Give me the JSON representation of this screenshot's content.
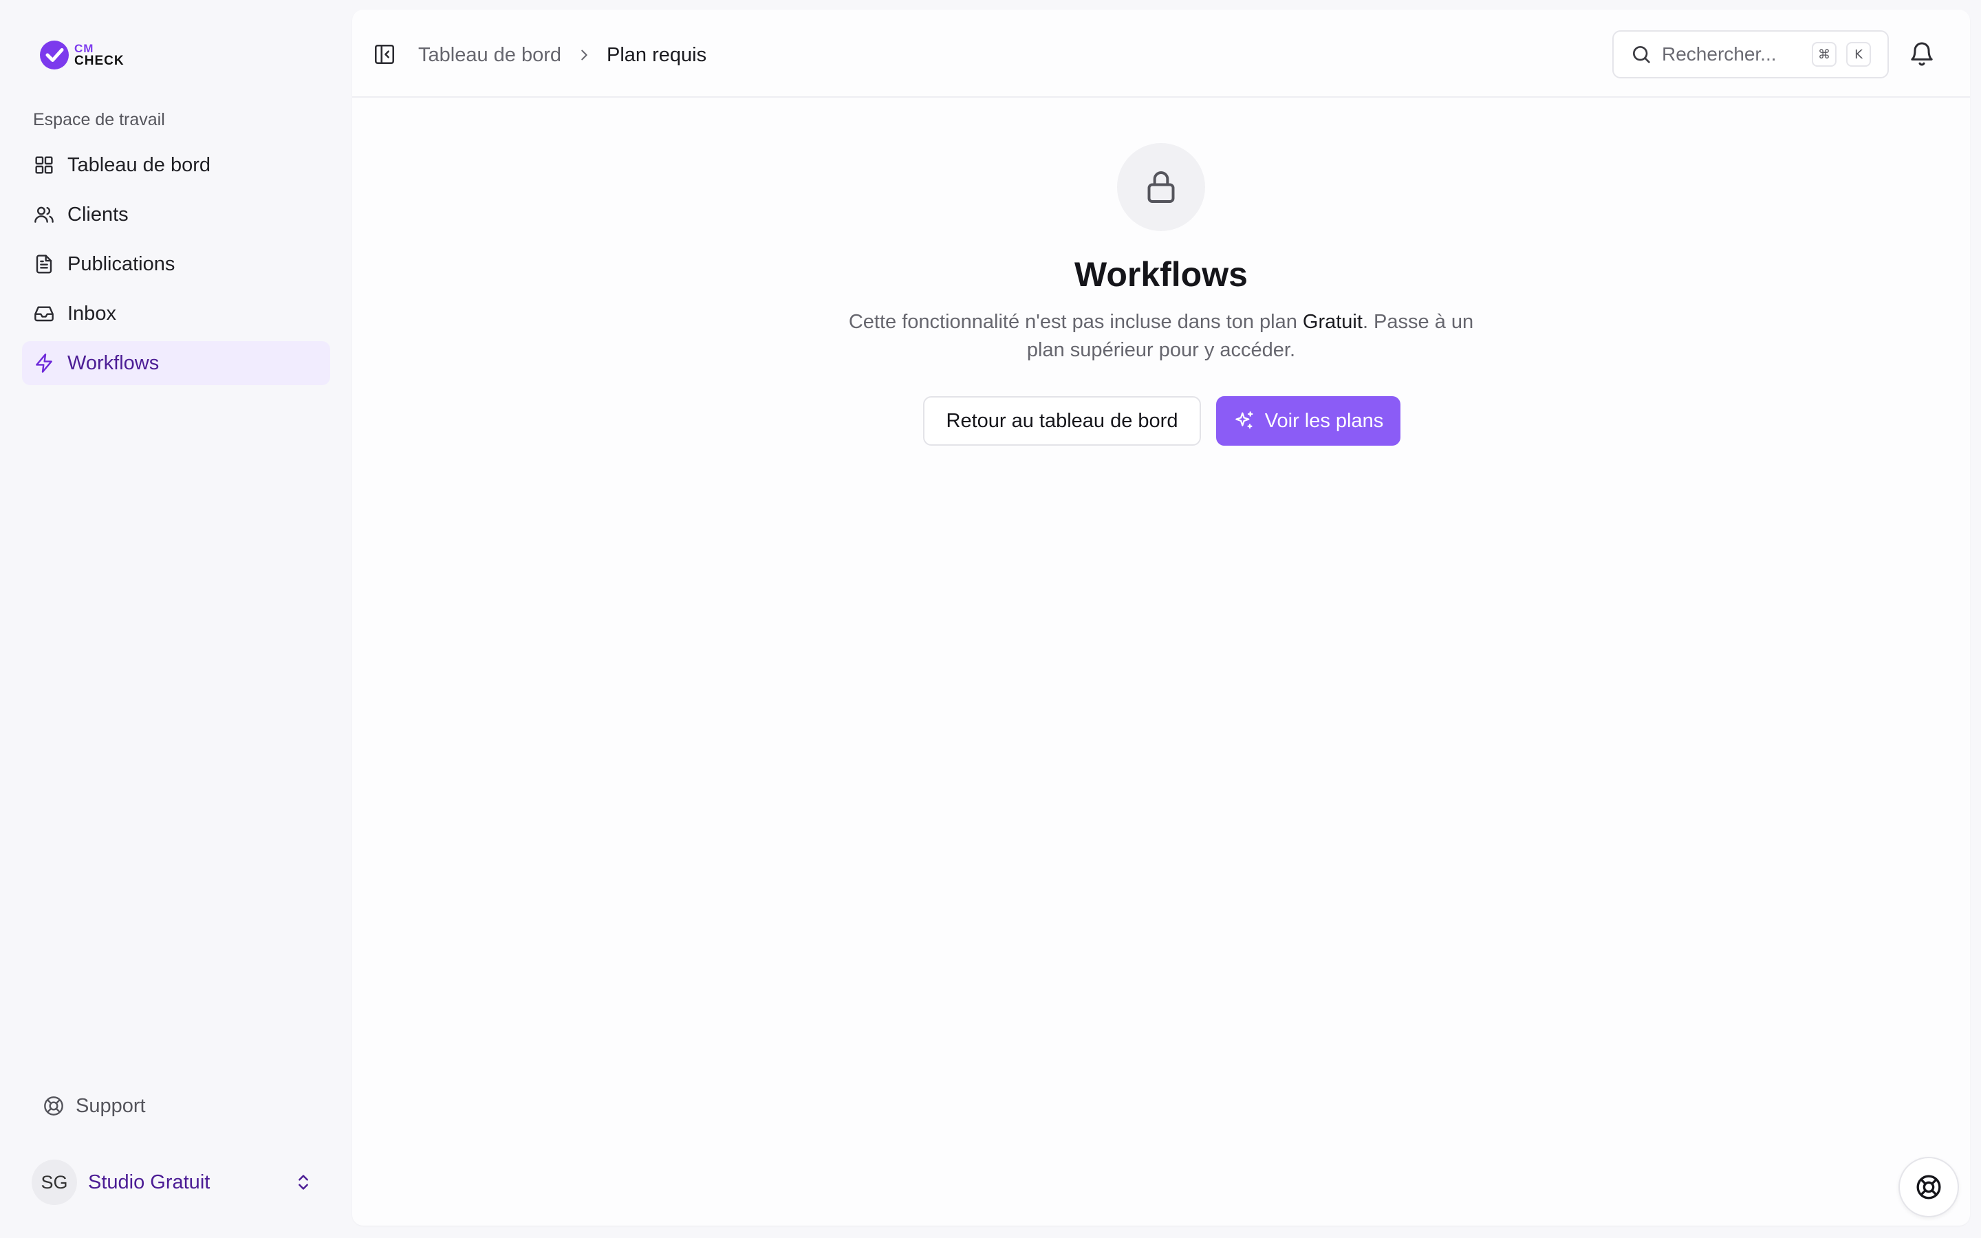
{
  "brand": {
    "logo_top": "CM",
    "logo_bottom": "CHECK",
    "accent_color": "#8b5cf6"
  },
  "sidebar": {
    "section_title": "Espace de travail",
    "items": [
      {
        "label": "Tableau de bord",
        "icon": "grid-icon",
        "active": false
      },
      {
        "label": "Clients",
        "icon": "users-icon",
        "active": false
      },
      {
        "label": "Publications",
        "icon": "document-icon",
        "active": false
      },
      {
        "label": "Inbox",
        "icon": "inbox-icon",
        "active": false
      },
      {
        "label": "Workflows",
        "icon": "lightning-icon",
        "active": true
      }
    ],
    "support_label": "Support",
    "account": {
      "initials": "SG",
      "name": "Studio Gratuit"
    }
  },
  "header": {
    "breadcrumb": {
      "parent": "Tableau de bord",
      "current": "Plan requis"
    },
    "search": {
      "placeholder": "Rechercher...",
      "shortcut_mod": "⌘",
      "shortcut_key": "K"
    }
  },
  "main": {
    "title": "Workflows",
    "description_before": "Cette fonctionnalité n'est pas incluse dans ton plan ",
    "plan_name": "Gratuit",
    "description_after": ". Passe à un plan supérieur pour y accéder.",
    "back_button": "Retour au tableau de bord",
    "plans_button": "Voir les plans"
  }
}
